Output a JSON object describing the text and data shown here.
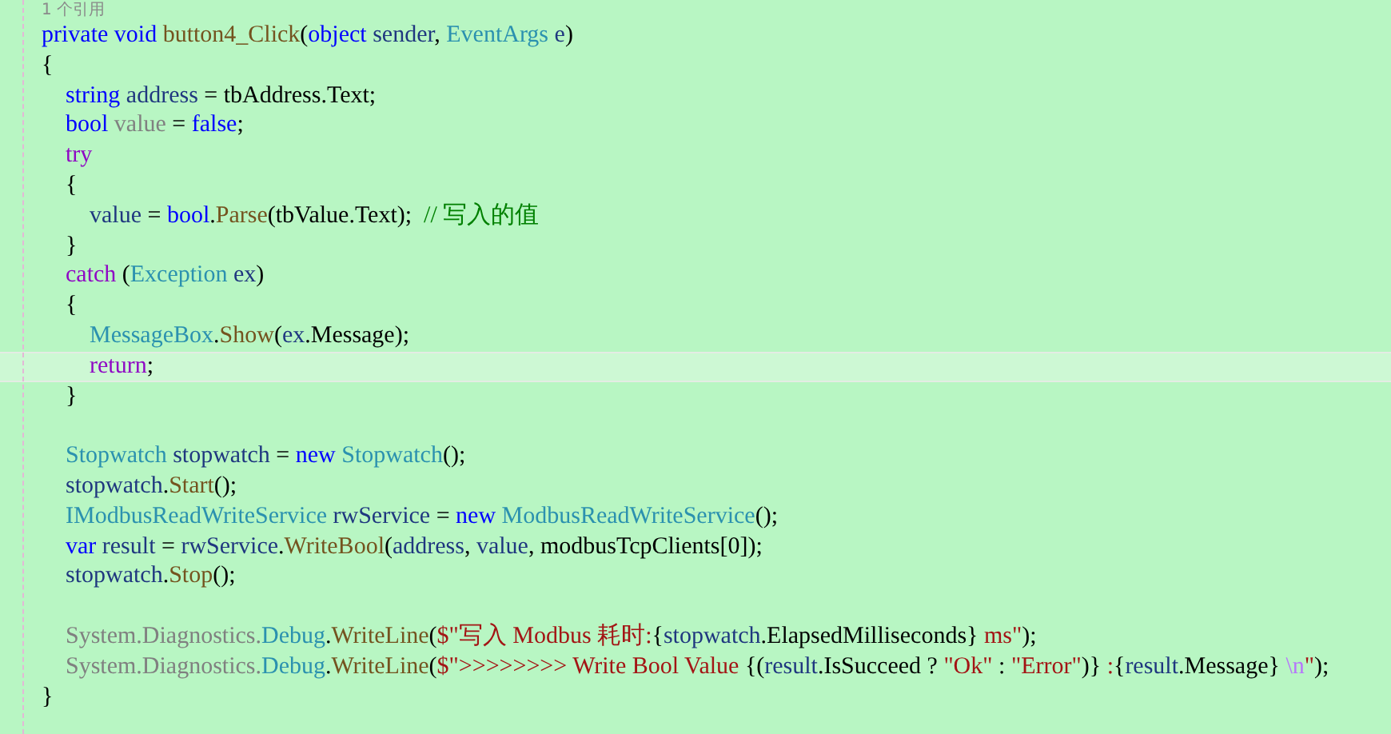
{
  "codelens": {
    "text": "1 个引用"
  },
  "lines": [
    {
      "current": false,
      "tokens": [
        {
          "kind": "kw",
          "text": "private void "
        },
        {
          "kind": "method",
          "text": "button4_Click"
        },
        {
          "kind": "plain",
          "text": "("
        },
        {
          "kind": "kw",
          "text": "object "
        },
        {
          "kind": "local",
          "text": "sender"
        },
        {
          "kind": "plain",
          "text": ", "
        },
        {
          "kind": "type",
          "text": "EventArgs"
        },
        {
          "kind": "local",
          "text": " e"
        },
        {
          "kind": "plain",
          "text": ")"
        }
      ]
    },
    {
      "current": false,
      "tokens": [
        {
          "kind": "plain",
          "text": "{"
        }
      ]
    },
    {
      "current": false,
      "tokens": [
        {
          "kind": "kw",
          "text": "    string "
        },
        {
          "kind": "local",
          "text": "address"
        },
        {
          "kind": "plain",
          "text": " = tbAddress.Text;"
        }
      ]
    },
    {
      "current": false,
      "tokens": [
        {
          "kind": "kw",
          "text": "    bool "
        },
        {
          "kind": "dim",
          "text": "value"
        },
        {
          "kind": "plain",
          "text": " = "
        },
        {
          "kind": "kw",
          "text": "false"
        },
        {
          "kind": "plain",
          "text": ";"
        }
      ]
    },
    {
      "current": false,
      "tokens": [
        {
          "kind": "ctrl",
          "text": "    try"
        }
      ]
    },
    {
      "current": false,
      "tokens": [
        {
          "kind": "plain",
          "text": "    {"
        }
      ]
    },
    {
      "current": false,
      "tokens": [
        {
          "kind": "local",
          "text": "        value"
        },
        {
          "kind": "plain",
          "text": " = "
        },
        {
          "kind": "kw",
          "text": "bool"
        },
        {
          "kind": "plain",
          "text": "."
        },
        {
          "kind": "method",
          "text": "Parse"
        },
        {
          "kind": "plain",
          "text": "(tbValue.Text);  "
        },
        {
          "kind": "comment",
          "text": "// 写入的值"
        }
      ]
    },
    {
      "current": false,
      "tokens": [
        {
          "kind": "plain",
          "text": "    }"
        }
      ]
    },
    {
      "current": false,
      "tokens": [
        {
          "kind": "ctrl",
          "text": "    catch"
        },
        {
          "kind": "plain",
          "text": " ("
        },
        {
          "kind": "type",
          "text": "Exception"
        },
        {
          "kind": "local",
          "text": " ex"
        },
        {
          "kind": "plain",
          "text": ")"
        }
      ]
    },
    {
      "current": false,
      "tokens": [
        {
          "kind": "plain",
          "text": "    {"
        }
      ]
    },
    {
      "current": false,
      "tokens": [
        {
          "kind": "type",
          "text": "        MessageBox"
        },
        {
          "kind": "plain",
          "text": "."
        },
        {
          "kind": "method",
          "text": "Show"
        },
        {
          "kind": "plain",
          "text": "("
        },
        {
          "kind": "local",
          "text": "ex"
        },
        {
          "kind": "plain",
          "text": ".Message);"
        }
      ]
    },
    {
      "current": true,
      "tokens": [
        {
          "kind": "ctrl",
          "text": "        return"
        },
        {
          "kind": "plain",
          "text": ";"
        }
      ]
    },
    {
      "current": false,
      "tokens": [
        {
          "kind": "plain",
          "text": "    }"
        }
      ]
    },
    {
      "current": false
    },
    {
      "current": false,
      "tokens": [
        {
          "kind": "type",
          "text": "    Stopwatch"
        },
        {
          "kind": "local",
          "text": " stopwatch"
        },
        {
          "kind": "plain",
          "text": " = "
        },
        {
          "kind": "kw",
          "text": "new "
        },
        {
          "kind": "type",
          "text": "Stopwatch"
        },
        {
          "kind": "plain",
          "text": "();"
        }
      ]
    },
    {
      "current": false,
      "tokens": [
        {
          "kind": "local",
          "text": "    stopwatch"
        },
        {
          "kind": "plain",
          "text": "."
        },
        {
          "kind": "method",
          "text": "Start"
        },
        {
          "kind": "plain",
          "text": "();"
        }
      ]
    },
    {
      "current": false,
      "tokens": [
        {
          "kind": "type",
          "text": "    IModbusReadWriteService"
        },
        {
          "kind": "local",
          "text": " rwService"
        },
        {
          "kind": "plain",
          "text": " = "
        },
        {
          "kind": "kw",
          "text": "new "
        },
        {
          "kind": "type",
          "text": "ModbusReadWriteService"
        },
        {
          "kind": "plain",
          "text": "();"
        }
      ]
    },
    {
      "current": false,
      "tokens": [
        {
          "kind": "kw",
          "text": "    var "
        },
        {
          "kind": "local",
          "text": "result"
        },
        {
          "kind": "plain",
          "text": " = "
        },
        {
          "kind": "local",
          "text": "rwService"
        },
        {
          "kind": "plain",
          "text": "."
        },
        {
          "kind": "method",
          "text": "WriteBool"
        },
        {
          "kind": "plain",
          "text": "("
        },
        {
          "kind": "local",
          "text": "address"
        },
        {
          "kind": "plain",
          "text": ", "
        },
        {
          "kind": "local",
          "text": "value"
        },
        {
          "kind": "plain",
          "text": ", modbusTcpClients[0]);"
        }
      ]
    },
    {
      "current": false,
      "tokens": [
        {
          "kind": "local",
          "text": "    stopwatch"
        },
        {
          "kind": "plain",
          "text": "."
        },
        {
          "kind": "method",
          "text": "Stop"
        },
        {
          "kind": "plain",
          "text": "();"
        }
      ]
    },
    {
      "current": false
    },
    {
      "current": false,
      "tokens": [
        {
          "kind": "dim",
          "text": "    System.Diagnostics."
        },
        {
          "kind": "type",
          "text": "Debug"
        },
        {
          "kind": "plain",
          "text": "."
        },
        {
          "kind": "method",
          "text": "WriteLine"
        },
        {
          "kind": "plain",
          "text": "("
        },
        {
          "kind": "string",
          "text": "$\"写入 Modbus 耗时:"
        },
        {
          "kind": "plain",
          "text": "{"
        },
        {
          "kind": "local",
          "text": "stopwatch"
        },
        {
          "kind": "plain",
          "text": ".ElapsedMilliseconds}"
        },
        {
          "kind": "string",
          "text": " ms\""
        },
        {
          "kind": "plain",
          "text": ");"
        }
      ]
    },
    {
      "current": false,
      "tokens": [
        {
          "kind": "dim",
          "text": "    System.Diagnostics."
        },
        {
          "kind": "type",
          "text": "Debug"
        },
        {
          "kind": "plain",
          "text": "."
        },
        {
          "kind": "method",
          "text": "WriteLine"
        },
        {
          "kind": "plain",
          "text": "("
        },
        {
          "kind": "string",
          "text": "$\">>>>>>>> Write Bool Value "
        },
        {
          "kind": "plain",
          "text": "{("
        },
        {
          "kind": "local",
          "text": "result"
        },
        {
          "kind": "plain",
          "text": ".IsSucceed ? "
        },
        {
          "kind": "string",
          "text": "\"Ok\""
        },
        {
          "kind": "plain",
          "text": " : "
        },
        {
          "kind": "string",
          "text": "\"Error\""
        },
        {
          "kind": "plain",
          "text": ")}"
        },
        {
          "kind": "string",
          "text": " :"
        },
        {
          "kind": "plain",
          "text": "{"
        },
        {
          "kind": "local",
          "text": "result"
        },
        {
          "kind": "plain",
          "text": ".Message} "
        },
        {
          "kind": "escape",
          "text": "\\n"
        },
        {
          "kind": "string",
          "text": "\""
        },
        {
          "kind": "plain",
          "text": ");"
        }
      ]
    },
    {
      "current": false,
      "tokens": [
        {
          "kind": "plain",
          "text": "}"
        }
      ]
    }
  ]
}
